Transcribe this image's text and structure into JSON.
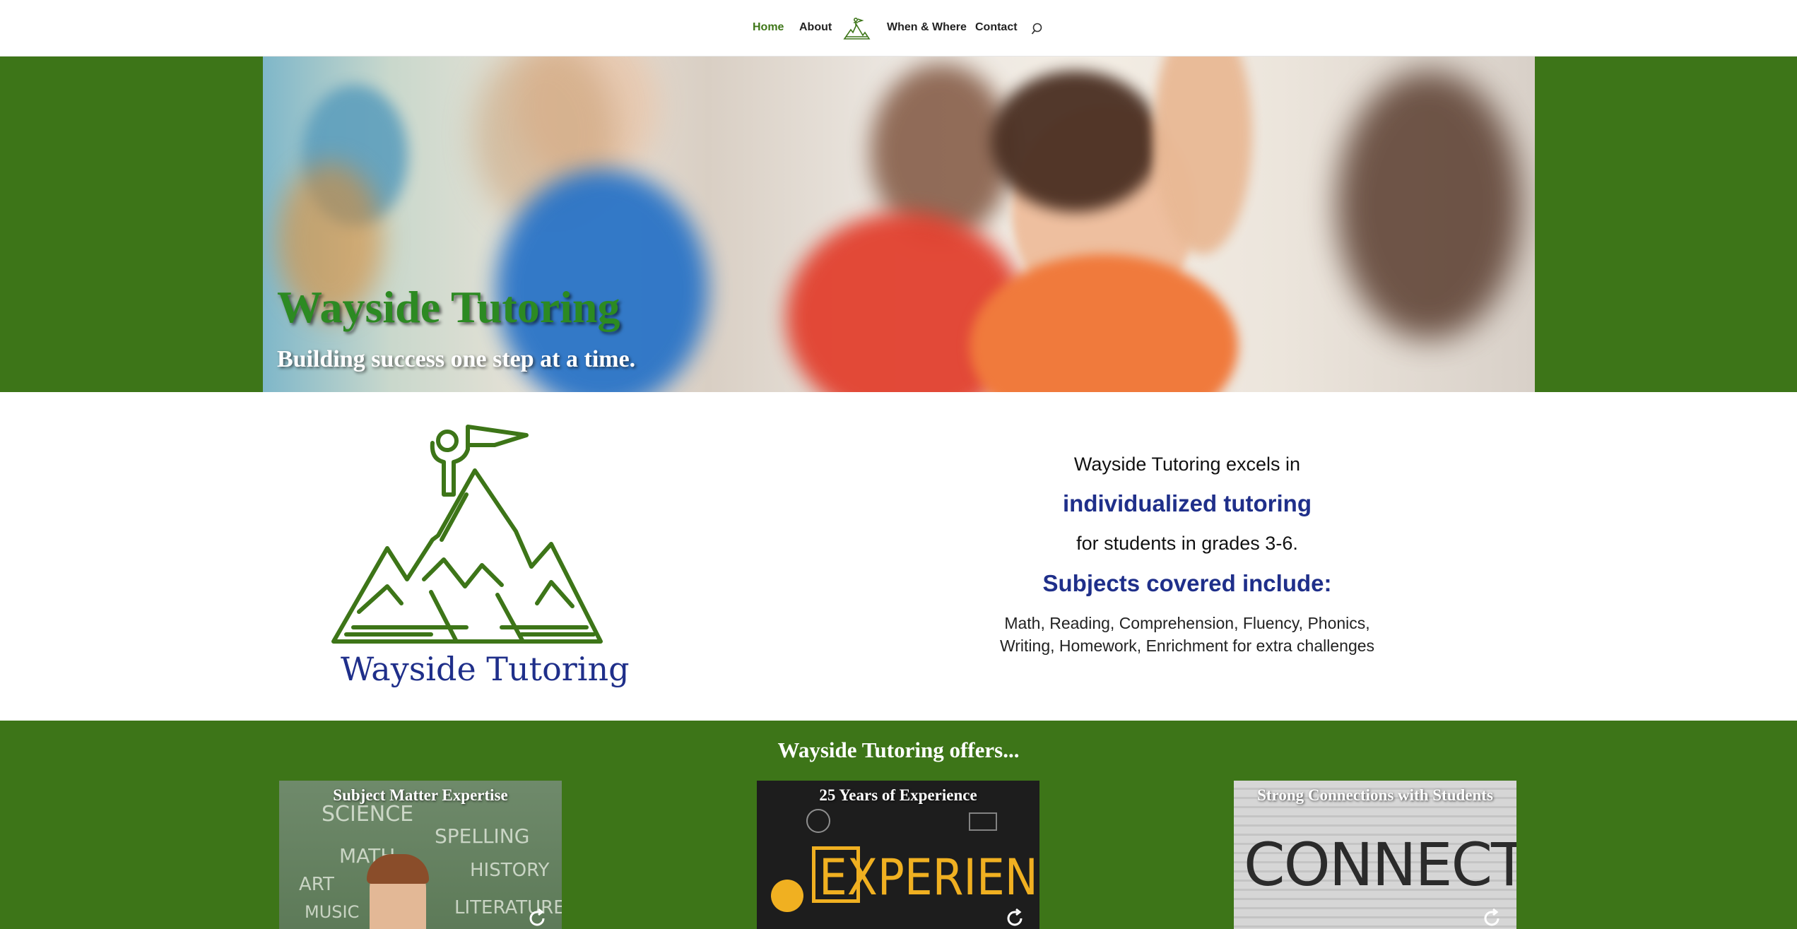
{
  "nav": {
    "items": [
      {
        "label": "Home",
        "active": true
      },
      {
        "label": "About"
      },
      {
        "label": "When & Where"
      },
      {
        "label": "Contact"
      }
    ],
    "logo_icon": "mountain-climber-logo",
    "search_icon": "search-icon"
  },
  "hero": {
    "title": "Wayside Tutoring",
    "subtitle": "Building success one step at a time."
  },
  "intro": {
    "logo_name": "Wayside Tutoring",
    "line1": "Wayside Tutoring excels in",
    "highlight1": "individualized tutoring",
    "line2": "for students in grades 3-6.",
    "highlight2": "Subjects covered include:",
    "subjects_line1": "Math, Reading, Comprehension, Fluency, Phonics,",
    "subjects_line2": "Writing, Homework, Enrichment for extra challenges"
  },
  "offers": {
    "title": "Wayside Tutoring offers...",
    "cards": [
      {
        "title": "Subject Matter Expertise",
        "image_words": [
          "SCIENCE",
          "MATH",
          "SPELLING",
          "ART",
          "HISTORY",
          "MUSIC",
          "LITERATURE"
        ]
      },
      {
        "title": "25 Years of Experience",
        "image_word": "EXPERIENCE"
      },
      {
        "title": "Strong Connections with Students",
        "image_word": "CONNECT"
      }
    ]
  },
  "colors": {
    "brand_green": "#3d7518",
    "brand_blue": "#1f2f8a",
    "nav_active": "#3e7618"
  }
}
